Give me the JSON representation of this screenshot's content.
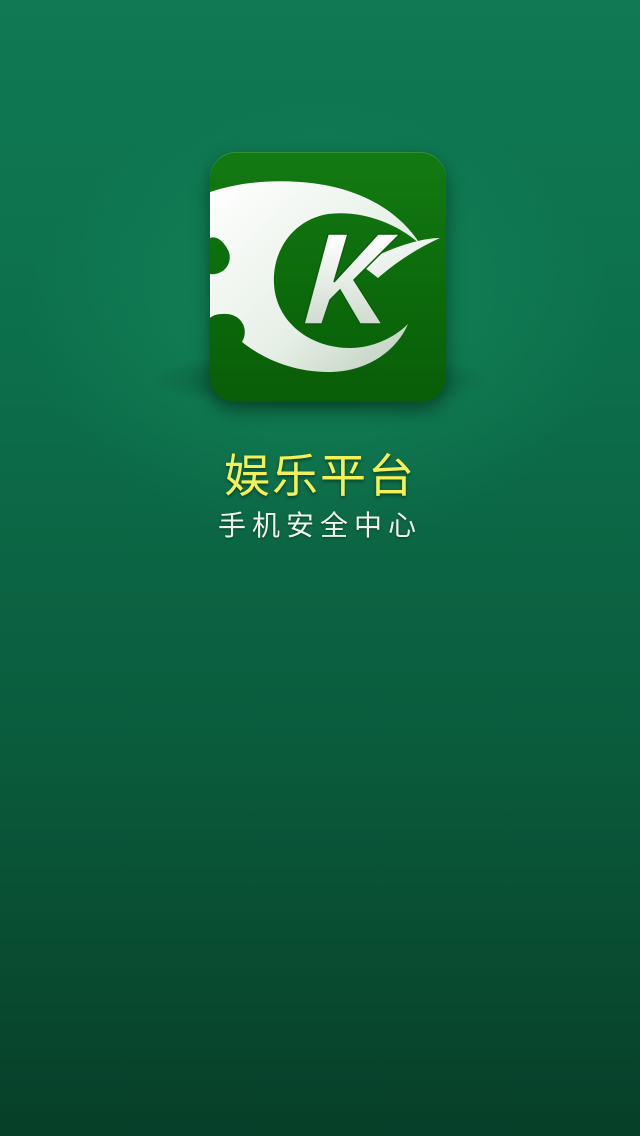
{
  "splash": {
    "logo_icon": "k-swirl-logo-icon",
    "logo_letter": "K",
    "app_name": "娱乐平台",
    "subtitle": "手机安全中心"
  },
  "colors": {
    "background_top": "#0f7a54",
    "background_bottom": "#073f29",
    "logo_bg": "#0c6a0b",
    "title": "#f3f05a",
    "subtitle": "#eef6f0"
  }
}
